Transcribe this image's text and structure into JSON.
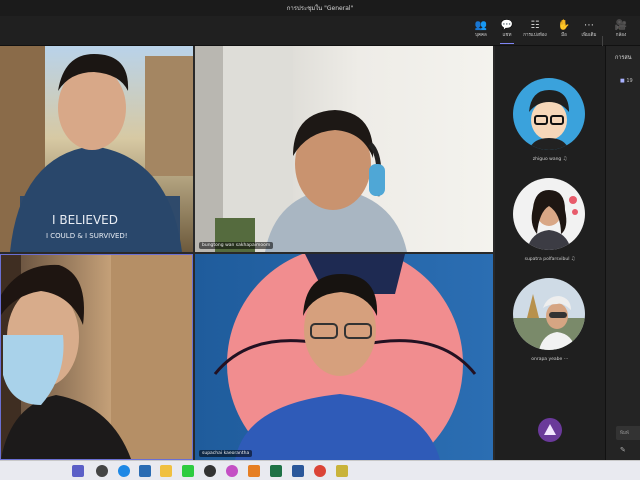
{
  "window": {
    "title": "การประชุมใน \"General\""
  },
  "toolbar": {
    "items": [
      {
        "label": "บุคคล",
        "icon": "people-icon"
      },
      {
        "label": "แชท",
        "icon": "chat-icon"
      },
      {
        "label": "การแบ่งห้อง",
        "icon": "breakout-rooms-icon"
      },
      {
        "label": "มือ",
        "icon": "raise-hand-icon"
      },
      {
        "label": "เพิ่มเติม",
        "icon": "more-icon"
      },
      {
        "label": "กล้อง",
        "icon": "camera-icon"
      }
    ]
  },
  "video": {
    "tile1": {
      "shirt_text_1": "I BELIEVED",
      "shirt_text_2": "I COULD & I SURVIVED!"
    },
    "tile2": {
      "name": "bungtong wan sakhapaimoom"
    },
    "tile4": {
      "name": "supachai kaeorantha"
    }
  },
  "people": [
    {
      "name": "zhiguo wang"
    },
    {
      "name": "supatra polfarsvibul"
    },
    {
      "name": "onrapa yeabe"
    }
  ],
  "chat": {
    "title": "การสน",
    "row": "19",
    "input_placeholder": "พิมพ์"
  },
  "colors": {
    "accent": "#7f85f5",
    "bg": "#292929"
  }
}
